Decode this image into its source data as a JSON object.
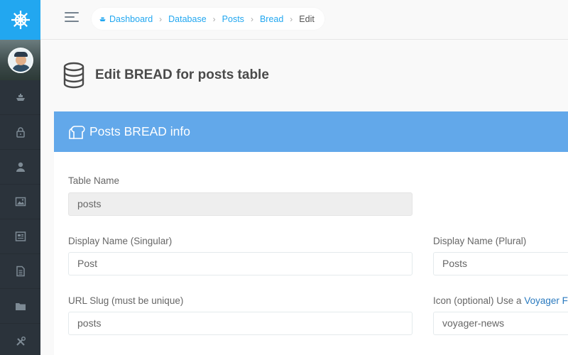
{
  "breadcrumb": [
    "Dashboard",
    "Database",
    "Posts",
    "Bread",
    "Edit"
  ],
  "page": {
    "title": "Edit BREAD for posts table"
  },
  "panel": {
    "title": "Posts BREAD info"
  },
  "form": {
    "table_name": {
      "label": "Table Name",
      "value": "posts"
    },
    "display_singular": {
      "label": "Display Name (Singular)",
      "value": "Post"
    },
    "display_plural": {
      "label": "Display Name (Plural)",
      "value": "Posts"
    },
    "url_slug": {
      "label": "URL Slug (must be unique)",
      "value": "posts"
    },
    "icon": {
      "label": "Icon (optional) Use a ",
      "link": "Voyager F",
      "value": "voyager-news"
    }
  },
  "sidebar": {
    "icons": [
      "helm-icon",
      "boat-icon",
      "lock-icon",
      "user-icon",
      "image-icon",
      "news-icon",
      "document-icon",
      "folder-icon",
      "tools-icon"
    ]
  },
  "colors": {
    "accent": "#22a7f0",
    "panel_heading": "#62a8ea",
    "sidebar": "#2b333b"
  }
}
